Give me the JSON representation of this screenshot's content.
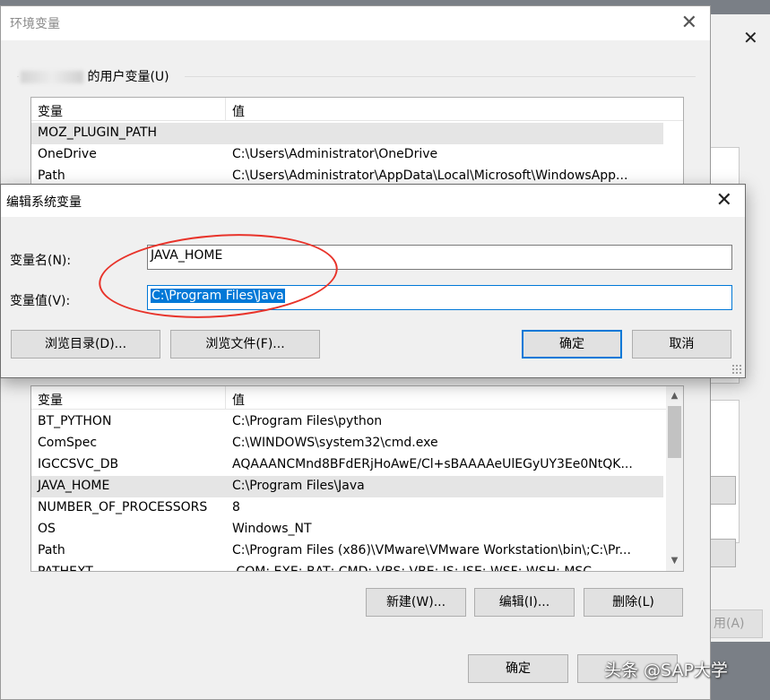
{
  "env_window": {
    "title": "环境变量",
    "user_vars_label": "的用户变量(U)",
    "headers": [
      "变量",
      "值"
    ],
    "user_vars": [
      {
        "name": "MOZ_PLUGIN_PATH",
        "value": ""
      },
      {
        "name": "OneDrive",
        "value": "C:\\Users\\Administrator\\OneDrive"
      },
      {
        "name": "Path",
        "value": "C:\\Users\\Administrator\\AppData\\Local\\Microsoft\\WindowsApp..."
      }
    ],
    "system_vars": [
      {
        "name": "BT_PYTHON",
        "value": "C:\\Program Files\\python"
      },
      {
        "name": "ComSpec",
        "value": "C:\\WINDOWS\\system32\\cmd.exe"
      },
      {
        "name": "IGCCSVC_DB",
        "value": "AQAAANCMnd8BFdERjHoAwE/Cl+sBAAAAeUlEGyUY3Ee0NtQK..."
      },
      {
        "name": "JAVA_HOME",
        "value": "C:\\Program Files\\Java"
      },
      {
        "name": "NUMBER_OF_PROCESSORS",
        "value": "8"
      },
      {
        "name": "OS",
        "value": "Windows_NT"
      },
      {
        "name": "Path",
        "value": "C:\\Program Files (x86)\\VMware\\VMware Workstation\\bin\\;C:\\Pr..."
      },
      {
        "name": "PATHEXT",
        "value": ".COM;.EXE;.BAT;.CMD;.VBS;.VBE;.JS;.JSE;.WSF;.WSH;.MSC"
      }
    ],
    "selected_system_var": "JAVA_HOME",
    "new_label": "新建(W)...",
    "edit_label": "编辑(I)...",
    "delete_label": "删除(L)",
    "ok_label": "确定"
  },
  "background_window": {
    "apply_label": "用(A)"
  },
  "edit_dialog": {
    "title": "编辑系统变量",
    "name_label": "变量名(N):",
    "value_label": "变量值(V):",
    "name_value": "JAVA_HOME",
    "value_value": "C:\\Program Files\\Java",
    "browse_dir_label": "浏览目录(D)...",
    "browse_file_label": "浏览文件(F)...",
    "ok_label": "确定",
    "cancel_label": "取消"
  },
  "annotation_color": "#e8332a",
  "accent_color": "#0078d7",
  "watermark": "头条 @SAP大学"
}
